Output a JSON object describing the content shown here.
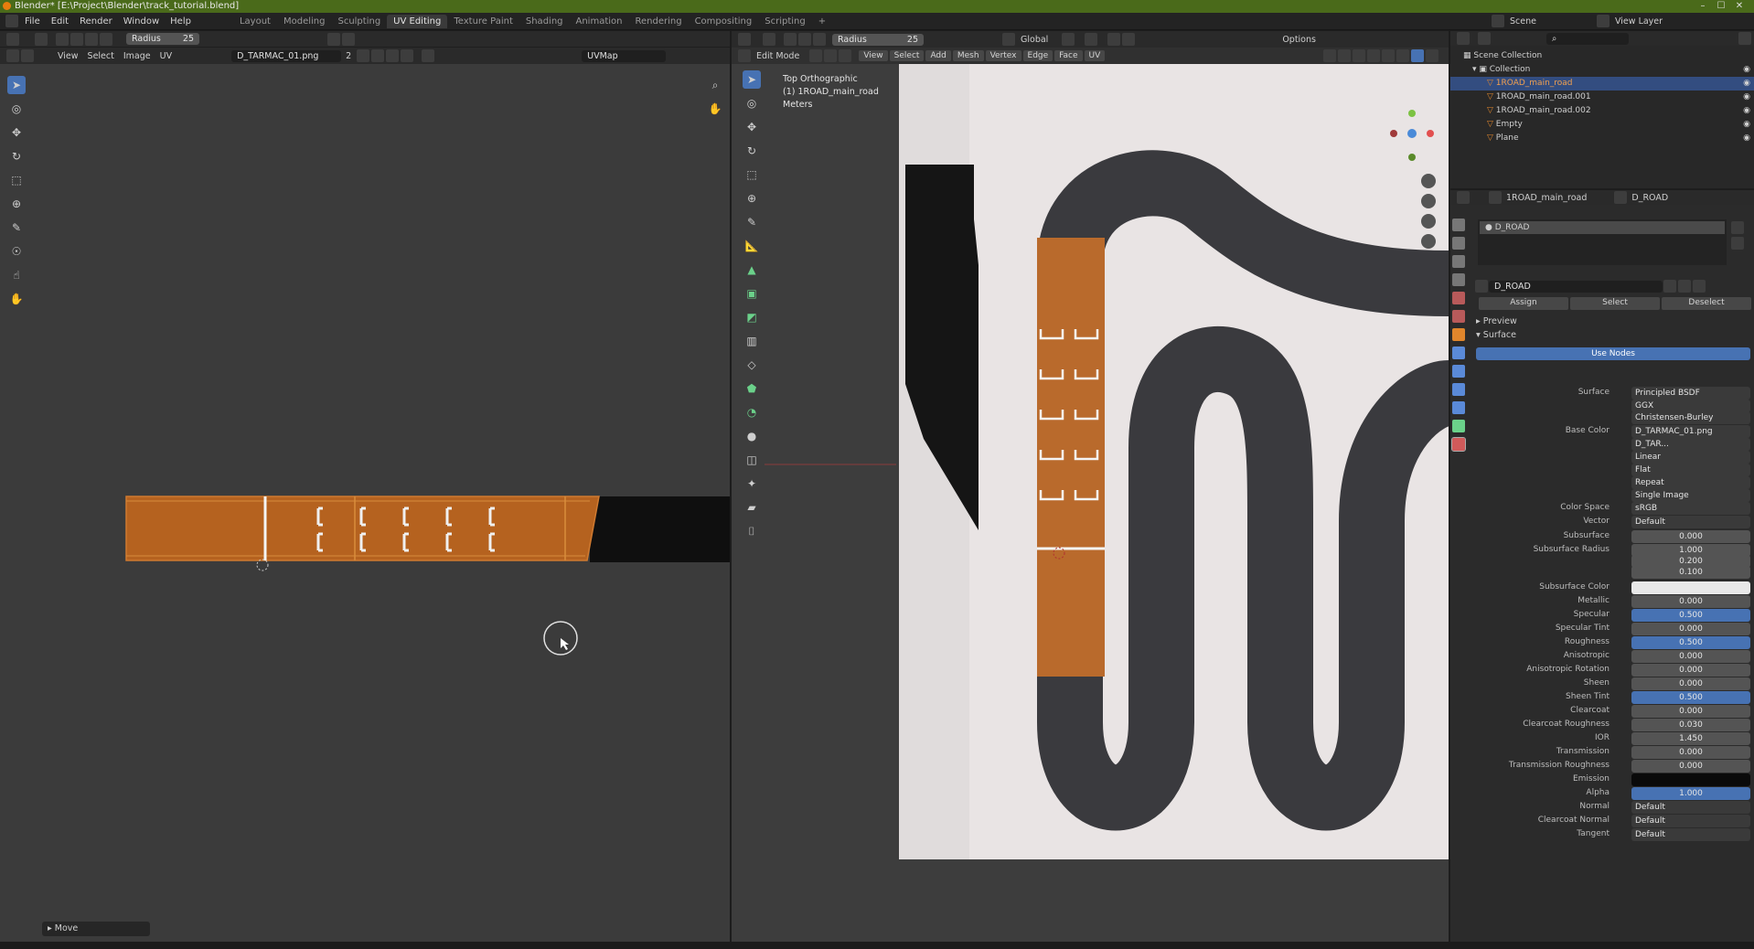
{
  "window": {
    "title": "Blender* [E:\\Project\\Blender\\track_tutorial.blend]",
    "minimize": "–",
    "maximize": "☐",
    "close": "✕"
  },
  "menu": [
    "File",
    "Edit",
    "Render",
    "Window",
    "Help"
  ],
  "workspaces": [
    "Layout",
    "Modeling",
    "Sculpting",
    "UV Editing",
    "Texture Paint",
    "Shading",
    "Animation",
    "Rendering",
    "Compositing",
    "Scripting"
  ],
  "active_workspace": "UV Editing",
  "add_workspace": "+",
  "scene": {
    "label": "Scene",
    "view_layer": "View Layer"
  },
  "uv_editor": {
    "radius_label": "Radius",
    "radius_value": "25",
    "menus": [
      "View",
      "Select",
      "Image",
      "UV"
    ],
    "image_name": "D_TARMAC_01.png",
    "image_users": "2",
    "uvmap": "UVMap",
    "last_op": "Move"
  },
  "viewport": {
    "radius_label": "Radius",
    "radius_value": "25",
    "orientation": "Global",
    "options": "Options",
    "mode": "Edit Mode",
    "menus": [
      "View",
      "Select",
      "Add",
      "Mesh",
      "Vertex",
      "Edge",
      "Face",
      "UV"
    ],
    "overlay_lines": [
      "Top Orthographic",
      "(1) 1ROAD_main_road",
      "Meters"
    ]
  },
  "outliner": {
    "root": "Scene Collection",
    "collection": "Collection",
    "items": [
      {
        "name": "1ROAD_main_road",
        "selected": true
      },
      {
        "name": "1ROAD_main_road.001",
        "selected": false
      },
      {
        "name": "1ROAD_main_road.002",
        "selected": false
      },
      {
        "name": "Empty",
        "selected": false
      },
      {
        "name": "Plane",
        "selected": false
      }
    ]
  },
  "properties": {
    "object": "1ROAD_main_road",
    "material": "D_ROAD",
    "slot": "D_ROAD",
    "assign": "Assign",
    "select": "Select",
    "deselect": "Deselect",
    "preview": "Preview",
    "surface_panel": "Surface",
    "use_nodes": "Use Nodes",
    "rows": [
      {
        "label": "Surface",
        "value": "Principled BSDF",
        "style": "dd"
      },
      {
        "label": "",
        "value": "GGX",
        "style": "dd"
      },
      {
        "label": "",
        "value": "Christensen-Burley",
        "style": "dd"
      },
      {
        "label": "Base Color",
        "value": "D_TARMAC_01.png",
        "style": "dd"
      },
      {
        "label": "",
        "value": "D_TAR...",
        "style": "dd"
      },
      {
        "label": "",
        "value": "Linear",
        "style": "dd"
      },
      {
        "label": "",
        "value": "Flat",
        "style": "dd"
      },
      {
        "label": "",
        "value": "Repeat",
        "style": "dd"
      },
      {
        "label": "",
        "value": "Single Image",
        "style": "dd"
      },
      {
        "label": "Color Space",
        "value": "sRGB",
        "style": "dd"
      },
      {
        "label": "Vector",
        "value": "Default",
        "style": "dd"
      },
      {
        "label": "Subsurface",
        "value": "0.000",
        "style": "num"
      },
      {
        "label": "Subsurface Radius",
        "value": "1.000",
        "style": "num"
      },
      {
        "label": "",
        "value": "0.200",
        "style": "num"
      },
      {
        "label": "",
        "value": "0.100",
        "style": "num"
      },
      {
        "label": "Subsurface Color",
        "value": "",
        "style": "white"
      },
      {
        "label": "Metallic",
        "value": "0.000",
        "style": "num"
      },
      {
        "label": "Specular",
        "value": "0.500",
        "style": "blue"
      },
      {
        "label": "Specular Tint",
        "value": "0.000",
        "style": "num"
      },
      {
        "label": "Roughness",
        "value": "0.500",
        "style": "blue"
      },
      {
        "label": "Anisotropic",
        "value": "0.000",
        "style": "num"
      },
      {
        "label": "Anisotropic Rotation",
        "value": "0.000",
        "style": "num"
      },
      {
        "label": "Sheen",
        "value": "0.000",
        "style": "num"
      },
      {
        "label": "Sheen Tint",
        "value": "0.500",
        "style": "blue"
      },
      {
        "label": "Clearcoat",
        "value": "0.000",
        "style": "num"
      },
      {
        "label": "Clearcoat Roughness",
        "value": "0.030",
        "style": "num"
      },
      {
        "label": "IOR",
        "value": "1.450",
        "style": "num"
      },
      {
        "label": "Transmission",
        "value": "0.000",
        "style": "num"
      },
      {
        "label": "Transmission Roughness",
        "value": "0.000",
        "style": "num"
      },
      {
        "label": "Emission",
        "value": "",
        "style": "black"
      },
      {
        "label": "Alpha",
        "value": "1.000",
        "style": "blue"
      },
      {
        "label": "Normal",
        "value": "Default",
        "style": "dd"
      },
      {
        "label": "Clearcoat Normal",
        "value": "Default",
        "style": "dd"
      },
      {
        "label": "Tangent",
        "value": "Default",
        "style": "dd"
      }
    ]
  },
  "colors": {
    "accent": "#4772b3",
    "uv_orange": "#b5621f",
    "titlebar": "#4a6a1a",
    "selected_text": "#f0a050"
  }
}
